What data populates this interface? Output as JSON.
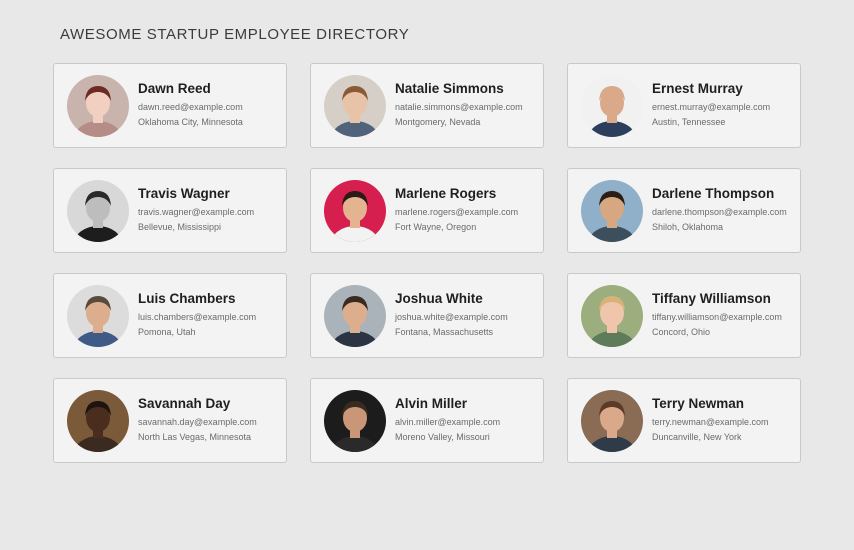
{
  "header": {
    "title": "AWESOME STARTUP EMPLOYEE DIRECTORY"
  },
  "employees": [
    {
      "name": "Dawn Reed",
      "email": "dawn.reed@example.com",
      "location": "Oklahoma City, Minnesota",
      "bg": "#c9b3ad",
      "skin": "#f1cfc1",
      "hair": "#6b2a22",
      "shirt": "#b58d86"
    },
    {
      "name": "Natalie Simmons",
      "email": "natalie.simmons@example.com",
      "location": "Montgomery, Nevada",
      "bg": "#d6cfc7",
      "skin": "#e9c3a8",
      "hair": "#8a5a37",
      "shirt": "#50637a"
    },
    {
      "name": "Ernest Murray",
      "email": "ernest.murray@example.com",
      "location": "Austin, Tennessee",
      "bg": "#f1f1f1",
      "skin": "#d9a98a",
      "hair": "#d9a98a",
      "shirt": "#2d3e5c"
    },
    {
      "name": "Travis Wagner",
      "email": "travis.wagner@example.com",
      "location": "Bellevue, Mississippi",
      "bg": "#d8d8d8",
      "skin": "#bdbdbd",
      "hair": "#2a2a2a",
      "shirt": "#1d1d1d"
    },
    {
      "name": "Marlene Rogers",
      "email": "marlene.rogers@example.com",
      "location": "Fort Wayne, Oregon",
      "bg": "#d61f4f",
      "skin": "#e3b48f",
      "hair": "#2b1a15",
      "shirt": "#f2f2f2"
    },
    {
      "name": "Darlene Thompson",
      "email": "darlene.thompson@example.com",
      "location": "Shiloh, Oklahoma",
      "bg": "#8fb0c8",
      "skin": "#d7a782",
      "hair": "#2b1e17",
      "shirt": "#3c4f5c"
    },
    {
      "name": "Luis Chambers",
      "email": "luis.chambers@example.com",
      "location": "Pomona, Utah",
      "bg": "#dcdcdc",
      "skin": "#dcae8e",
      "hair": "#5a4a3c",
      "shirt": "#3f5a86"
    },
    {
      "name": "Joshua White",
      "email": "joshua.white@example.com",
      "location": "Fontana, Massachusetts",
      "bg": "#a9b3b9",
      "skin": "#dcae8e",
      "hair": "#3a2a20",
      "shirt": "#2b3442"
    },
    {
      "name": "Tiffany Williamson",
      "email": "tiffany.williamson@example.com",
      "location": "Concord, Ohio",
      "bg": "#9cae7d",
      "skin": "#efc6ab",
      "hair": "#d7b37a",
      "shirt": "#5e7b5a"
    },
    {
      "name": "Savannah Day",
      "email": "savannah.day@example.com",
      "location": "North Las Vegas, Minnesota",
      "bg": "#7b5a3a",
      "skin": "#4a2d1f",
      "hair": "#1b1410",
      "shirt": "#3b2a20"
    },
    {
      "name": "Alvin Miller",
      "email": "alvin.miller@example.com",
      "location": "Moreno Valley, Missouri",
      "bg": "#1c1c1c",
      "skin": "#c99677",
      "hair": "#3a2a20",
      "shirt": "#2a2a2a"
    },
    {
      "name": "Terry Newman",
      "email": "terry.newman@example.com",
      "location": "Duncanville, New York",
      "bg": "#8a6c55",
      "skin": "#d9a98a",
      "hair": "#5a3b28",
      "shirt": "#2f3b48"
    }
  ]
}
